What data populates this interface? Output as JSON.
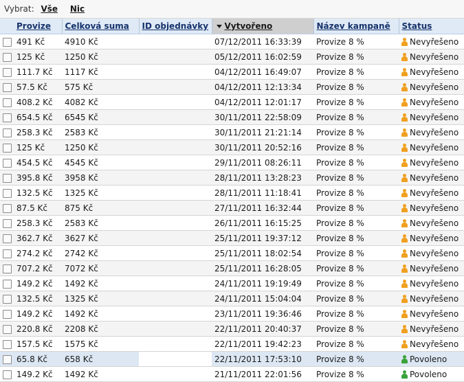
{
  "selection": {
    "label": "Vybrat:",
    "all": "Vše",
    "none": "Nic"
  },
  "columns": [
    {
      "key": "provize",
      "label": "Provize",
      "sorted": false
    },
    {
      "key": "suma",
      "label": "Celková suma",
      "sorted": false
    },
    {
      "key": "order_id",
      "label": "ID objednávky",
      "sorted": false
    },
    {
      "key": "created",
      "label": "Vytvořeno",
      "sorted": true,
      "sort_dir": "desc"
    },
    {
      "key": "campaign",
      "label": "Název kampaně",
      "sorted": false
    },
    {
      "key": "status",
      "label": "Status",
      "sorted": false
    }
  ],
  "status_colors": {
    "Nevyřešeno": "#f0a020",
    "Povoleno": "#3aa23a"
  },
  "colors": {
    "header_bg": "#dfeaf6",
    "sorted_header_bg": "#cfcfcf",
    "selected_row_bg": "#dce7f3",
    "alt_row_bg": "#f4f4f4"
  },
  "rows": [
    {
      "provize": "491 Kč",
      "suma": "4910 Kč",
      "order_id": "",
      "created": "07/12/2011 16:33:39",
      "campaign": "Provize 8 %",
      "status": "Nevyřešeno"
    },
    {
      "provize": "125 Kč",
      "suma": "1250 Kč",
      "order_id": "",
      "created": "05/12/2011 16:02:59",
      "campaign": "Provize 8 %",
      "status": "Nevyřešeno"
    },
    {
      "provize": "111.7 Kč",
      "suma": "1117 Kč",
      "order_id": "",
      "created": "04/12/2011 16:49:07",
      "campaign": "Provize 8 %",
      "status": "Nevyřešeno"
    },
    {
      "provize": "57.5 Kč",
      "suma": "575 Kč",
      "order_id": "",
      "created": "04/12/2011 12:13:34",
      "campaign": "Provize 8 %",
      "status": "Nevyřešeno"
    },
    {
      "provize": "408.2 Kč",
      "suma": "4082 Kč",
      "order_id": "",
      "created": "04/12/2011 12:01:17",
      "campaign": "Provize 8 %",
      "status": "Nevyřešeno"
    },
    {
      "provize": "654.5 Kč",
      "suma": "6545 Kč",
      "order_id": "",
      "created": "30/11/2011 22:58:09",
      "campaign": "Provize 8 %",
      "status": "Nevyřešeno"
    },
    {
      "provize": "258.3 Kč",
      "suma": "2583 Kč",
      "order_id": "",
      "created": "30/11/2011 21:21:14",
      "campaign": "Provize 8 %",
      "status": "Nevyřešeno"
    },
    {
      "provize": "125 Kč",
      "suma": "1250 Kč",
      "order_id": "",
      "created": "30/11/2011 20:52:16",
      "campaign": "Provize 8 %",
      "status": "Nevyřešeno"
    },
    {
      "provize": "454.5 Kč",
      "suma": "4545 Kč",
      "order_id": "",
      "created": "29/11/2011 08:26:11",
      "campaign": "Provize 8 %",
      "status": "Nevyřešeno"
    },
    {
      "provize": "395.8 Kč",
      "suma": "3958 Kč",
      "order_id": "",
      "created": "28/11/2011 13:28:23",
      "campaign": "Provize 8 %",
      "status": "Nevyřešeno"
    },
    {
      "provize": "132.5 Kč",
      "suma": "1325 Kč",
      "order_id": "",
      "created": "28/11/2011 11:18:41",
      "campaign": "Provize 8 %",
      "status": "Nevyřešeno"
    },
    {
      "provize": "87.5 Kč",
      "suma": "875 Kč",
      "order_id": "",
      "created": "27/11/2011 16:32:44",
      "campaign": "Provize 8 %",
      "status": "Nevyřešeno"
    },
    {
      "provize": "258.3 Kč",
      "suma": "2583 Kč",
      "order_id": "",
      "created": "26/11/2011 16:15:25",
      "campaign": "Provize 8 %",
      "status": "Nevyřešeno"
    },
    {
      "provize": "362.7 Kč",
      "suma": "3627 Kč",
      "order_id": "",
      "created": "25/11/2011 19:37:12",
      "campaign": "Provize 8 %",
      "status": "Nevyřešeno"
    },
    {
      "provize": "274.2 Kč",
      "suma": "2742 Kč",
      "order_id": "",
      "created": "25/11/2011 18:02:54",
      "campaign": "Provize 8 %",
      "status": "Nevyřešeno"
    },
    {
      "provize": "707.2 Kč",
      "suma": "7072 Kč",
      "order_id": "",
      "created": "25/11/2011 16:28:05",
      "campaign": "Provize 8 %",
      "status": "Nevyřešeno"
    },
    {
      "provize": "149.2 Kč",
      "suma": "1492 Kč",
      "order_id": "",
      "created": "24/11/2011 19:19:49",
      "campaign": "Provize 8 %",
      "status": "Nevyřešeno"
    },
    {
      "provize": "132.5 Kč",
      "suma": "1325 Kč",
      "order_id": "",
      "created": "24/11/2011 15:04:04",
      "campaign": "Provize 8 %",
      "status": "Nevyřešeno"
    },
    {
      "provize": "149.2 Kč",
      "suma": "1492 Kč",
      "order_id": "",
      "created": "23/11/2011 19:36:46",
      "campaign": "Provize 8 %",
      "status": "Nevyřešeno"
    },
    {
      "provize": "220.8 Kč",
      "suma": "2208 Kč",
      "order_id": "",
      "created": "22/11/2011 20:40:37",
      "campaign": "Provize 8 %",
      "status": "Nevyřešeno"
    },
    {
      "provize": "157.5 Kč",
      "suma": "1575 Kč",
      "order_id": "",
      "created": "22/11/2011 19:42:23",
      "campaign": "Provize 8 %",
      "status": "Nevyřešeno"
    },
    {
      "provize": "65.8 Kč",
      "suma": "658 Kč",
      "order_id": "",
      "created": "22/11/2011 17:53:10",
      "campaign": "Provize 8 %",
      "status": "Povoleno",
      "selected": true
    },
    {
      "provize": "149.2 Kč",
      "suma": "1492 Kč",
      "order_id": "",
      "created": "21/11/2011 22:01:56",
      "campaign": "Provize 8 %",
      "status": "Povoleno"
    }
  ]
}
